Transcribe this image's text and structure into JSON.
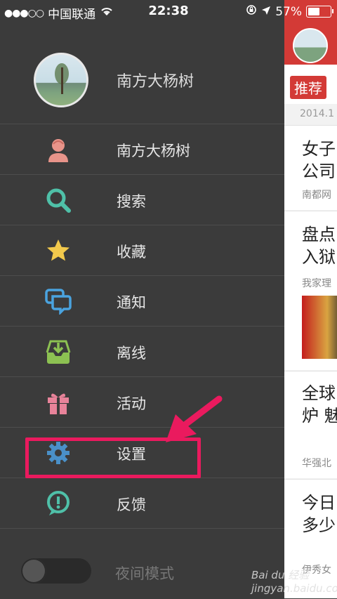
{
  "status": {
    "signal": "●●●○○",
    "carrier": "中国联通",
    "time": "22:38",
    "battery": "57%",
    "battery_level": 0.57
  },
  "profile": {
    "name": "南方大杨树"
  },
  "menu": [
    {
      "label": "南方大杨树",
      "icon": "user-icon",
      "color": "#e8948a"
    },
    {
      "label": "搜索",
      "icon": "search-icon",
      "color": "#4fc0a8"
    },
    {
      "label": "收藏",
      "icon": "star-icon",
      "color": "#f2c94c"
    },
    {
      "label": "通知",
      "icon": "chat-bubbles-icon",
      "color": "#4aa3df"
    },
    {
      "label": "离线",
      "icon": "download-tray-icon",
      "color": "#8cc152"
    },
    {
      "label": "活动",
      "icon": "gift-icon",
      "color": "#e8839a"
    },
    {
      "label": "设置",
      "icon": "gear-icon",
      "color": "#4a90c8"
    },
    {
      "label": "反馈",
      "icon": "feedback-icon",
      "color": "#4fc0a8"
    }
  ],
  "night_mode": {
    "label": "夜间模式",
    "enabled": false
  },
  "content": {
    "tab": "推荐",
    "date": "2014.1",
    "cards": [
      {
        "title1": "女子",
        "title2": "公司",
        "source": "南都网"
      },
      {
        "title1": "盘点",
        "title2": "入狱",
        "source": "我家理"
      },
      {
        "title1": "全球",
        "title2": "炉 魅",
        "source": "华强北"
      },
      {
        "title1": "今日",
        "title2": "多少",
        "source": "伊秀女"
      }
    ]
  },
  "watermark": "Bai du 经验 jingyan.baidu.com",
  "colors": {
    "highlight": "#ea1a5e",
    "brand_red": "#d33a36",
    "drawer_bg": "#3b3b3b"
  }
}
